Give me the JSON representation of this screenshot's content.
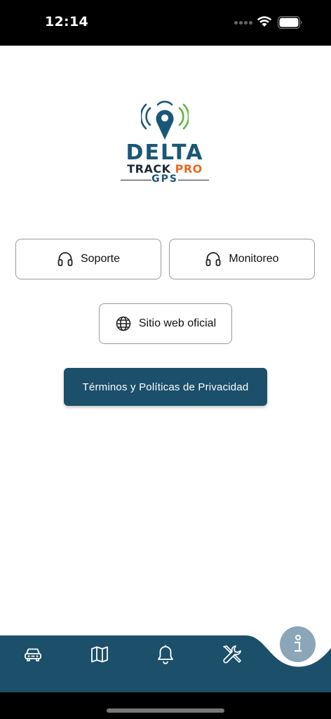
{
  "status_bar": {
    "time": "12:14"
  },
  "logo": {
    "line1": "DELTA",
    "line2_main": "TRACK",
    "line2_accent": "PRO",
    "line3": "GPS"
  },
  "buttons": {
    "support": {
      "label": "Soporte",
      "icon": "headset-icon"
    },
    "monitoring": {
      "label": "Monitoreo",
      "icon": "headset-icon"
    },
    "website": {
      "label": "Sitio web oficial",
      "icon": "globe-icon"
    },
    "terms": {
      "label": "Términos y Políticas de Privacidad"
    }
  },
  "bottom_nav": {
    "items": [
      {
        "icon": "car-icon"
      },
      {
        "icon": "map-icon"
      },
      {
        "icon": "bell-icon"
      },
      {
        "icon": "tools-icon"
      }
    ],
    "fab": {
      "icon": "info-icon"
    }
  },
  "colors": {
    "primary": "#1b4f6a",
    "accent": "#e86a1e",
    "fab": "#8ba6b8",
    "nav_bg": "#1b4f6a"
  }
}
